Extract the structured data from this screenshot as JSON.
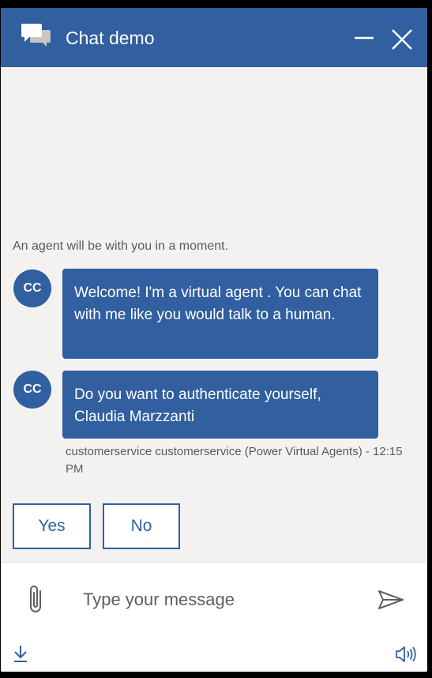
{
  "header": {
    "title": "Chat demo",
    "background": "#315fa0"
  },
  "transcript": {
    "system_message": "An agent will be with you in a moment.",
    "messages": [
      {
        "avatar_initials": "CC",
        "text": "Welcome! I'm a virtual agent . You can chat with me like you would talk to a human."
      },
      {
        "avatar_initials": "CC",
        "text": "Do you want to authenticate yourself, Claudia Marzzanti"
      }
    ],
    "meta": "customerservice customerservice (Power Virtual Agents) - 12:15 PM"
  },
  "suggested_actions": [
    "Yes",
    "No"
  ],
  "sendbox": {
    "placeholder": "Type your message"
  },
  "icons": {
    "header": "chat-icon",
    "minimize": "minimize-icon",
    "close": "close-icon",
    "attach": "paperclip-icon",
    "send": "send-icon",
    "download": "download-icon",
    "speaker": "speaker-icon"
  },
  "colors": {
    "accent": "#315fa0",
    "transcript_bg": "#f3f2f1",
    "sendbox_bg": "#ffffff"
  }
}
